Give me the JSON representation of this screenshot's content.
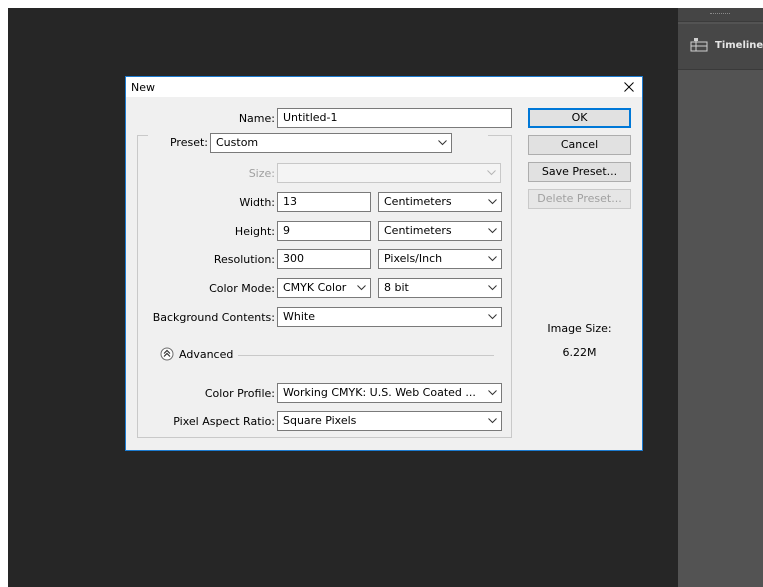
{
  "panel": {
    "tab_label": "Timeline"
  },
  "dialog": {
    "title": "New",
    "name": {
      "label": "Name:",
      "value": "Untitled-1"
    },
    "preset": {
      "label": "Preset:",
      "value": "Custom"
    },
    "size": {
      "label": "Size:",
      "value": ""
    },
    "width": {
      "label": "Width:",
      "value": "13",
      "unit": "Centimeters"
    },
    "height": {
      "label": "Height:",
      "value": "9",
      "unit": "Centimeters"
    },
    "resolution": {
      "label": "Resolution:",
      "value": "300",
      "unit": "Pixels/Inch"
    },
    "color_mode": {
      "label": "Color Mode:",
      "value": "CMYK Color",
      "depth": "8 bit"
    },
    "background": {
      "label": "Background Contents:",
      "value": "White"
    },
    "advanced": {
      "label": "Advanced"
    },
    "color_profile": {
      "label": "Color Profile:",
      "value": "Working CMYK:  U.S. Web Coated ..."
    },
    "pixel_aspect": {
      "label": "Pixel Aspect Ratio:",
      "value": "Square Pixels"
    },
    "buttons": {
      "ok": "OK",
      "cancel": "Cancel",
      "save_preset": "Save Preset...",
      "delete_preset": "Delete Preset..."
    },
    "image_size": {
      "label": "Image Size:",
      "value": "6.22M"
    }
  }
}
